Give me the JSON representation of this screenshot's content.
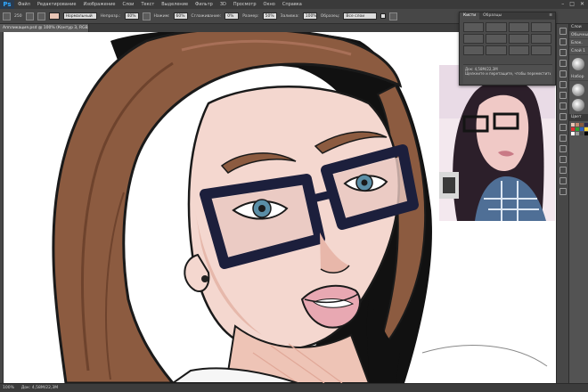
{
  "menu": {
    "logo": "Ps",
    "items": [
      "Файл",
      "Редактирование",
      "Изображение",
      "Слои",
      "Текст",
      "Выделение",
      "Фильтр",
      "3D",
      "Просмотр",
      "Окно",
      "Справка"
    ]
  },
  "options": {
    "brush_size": "250",
    "mode_value": "Нормальный",
    "opacity_label": "Непрозр.:",
    "opacity_value": "40%",
    "flow_label": "Нажим:",
    "flow_value": "60%",
    "smooth_label": "Сглаживание:",
    "smooth_value": "0%",
    "size_label": "Размер:",
    "size_value": "50%",
    "fill_label": "Заливка:",
    "fill_value": "100%",
    "sample_label": "Образец:",
    "sample_value": "Все слои"
  },
  "document_tab": "Аппликация.psd @ 100% (Контур 3, RGB/8) *",
  "float_panel": {
    "tabs": [
      "Кисти",
      "Образцы"
    ],
    "info_lines": [
      "Док: 4,58M/22,3M",
      "Щелкните и перетащите, чтобы переместить..."
    ]
  },
  "right_panel": {
    "header": "Слои",
    "rows": [
      "Обычные",
      "Блок.",
      "Слой 1",
      "Набор"
    ],
    "swatch_header": "Цвет",
    "swatch_colors": [
      "#e8c4b4",
      "#c48a6e",
      "#8a5a3c",
      "#2e2a4a",
      "#e03030",
      "#30a030",
      "#3060c0",
      "#f0d040",
      "#ffffff",
      "#9a9a9a",
      "#4a4a4a",
      "#000000"
    ]
  },
  "status": {
    "zoom": "100%",
    "doc": "Док: 4,58M/22,3M"
  }
}
